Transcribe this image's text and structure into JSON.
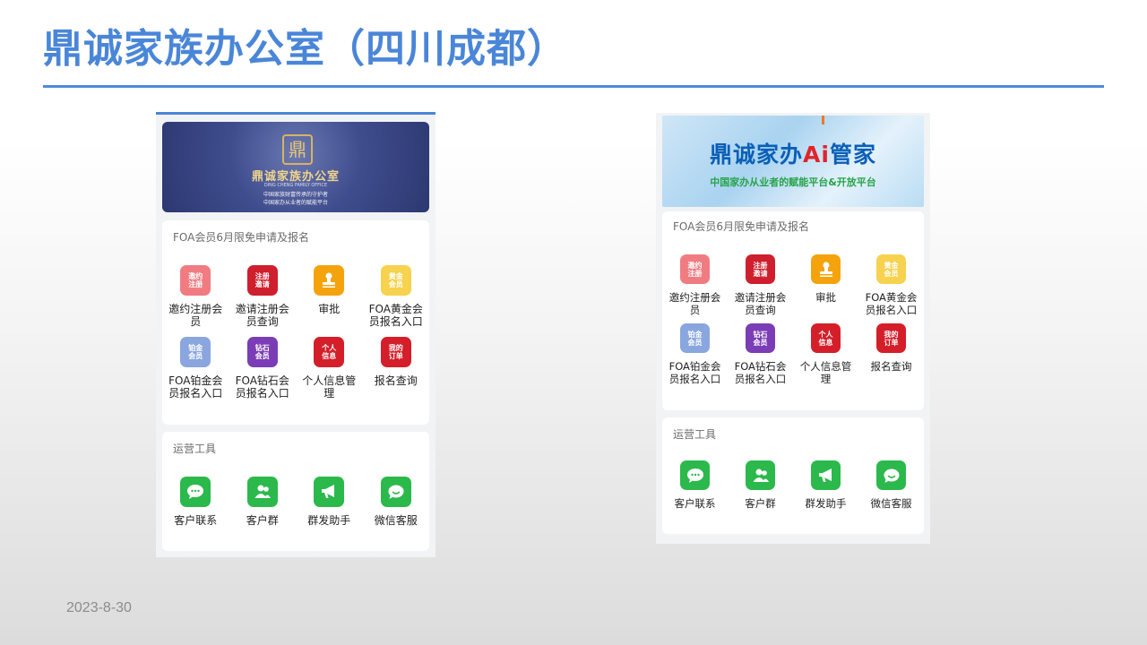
{
  "slide": {
    "title": "鼎诚家族办公室（四川成都）",
    "date": "2023-8-30",
    "accent_color": "#4a86d8"
  },
  "left_screen": {
    "banner": {
      "logo_glyph": "鼎",
      "name": "鼎诚家族办公室",
      "english": "DING CHENG FAMILY OFFICE",
      "slogan_1": "中国家族财富传承的守护者",
      "slogan_2": "中国家办从业者的赋能平台"
    },
    "foa": {
      "title": "FOA会员6月限免申请及报名",
      "items": [
        {
          "label": "邀约注册会员",
          "icon_text": "邀约注册",
          "icon": "invite-register-icon",
          "color": "#f07c82"
        },
        {
          "label": "邀请注册会员查询",
          "icon_text": "注册邀请",
          "icon": "invite-query-icon",
          "color": "#cf1f2e"
        },
        {
          "label": "审批",
          "icon_text": "",
          "icon": "approval-stamp-icon",
          "color": "#f5a30d"
        },
        {
          "label": "FOA黄金会员报名入口",
          "icon_text": "黄金会员",
          "icon": "gold-member-icon",
          "color": "#f6d24e"
        },
        {
          "label": "FOA铂金会员报名入口",
          "icon_text": "铂金会员",
          "icon": "platinum-member-icon",
          "color": "#8aa6de"
        },
        {
          "label": "FOA钻石会员报名入口",
          "icon_text": "钻石会员",
          "icon": "diamond-member-icon",
          "color": "#7b3db6"
        },
        {
          "label": "个人信息管理",
          "icon_text": "个人信息",
          "icon": "personal-info-icon",
          "color": "#d41f2a"
        },
        {
          "label": "报名查询",
          "icon_text": "我的订单",
          "icon": "my-orders-icon",
          "color": "#d41f2a"
        }
      ]
    },
    "tools": {
      "title": "运营工具",
      "items": [
        {
          "label": "客户联系",
          "icon": "chat-bubble-icon"
        },
        {
          "label": "客户群",
          "icon": "customer-group-icon"
        },
        {
          "label": "群发助手",
          "icon": "megaphone-icon"
        },
        {
          "label": "微信客服",
          "icon": "wechat-service-icon"
        }
      ]
    }
  },
  "right_screen": {
    "banner": {
      "name_pre": "鼎诚家办",
      "name_ai": "Ai",
      "name_post": "管家",
      "subtitle": "中国家办从业者的赋能平台&开放平台"
    },
    "foa": {
      "title": "FOA会员6月限免申请及报名",
      "items": [
        {
          "label": "邀约注册会员",
          "icon_text": "邀约注册",
          "icon": "invite-register-icon",
          "color": "#f07c82"
        },
        {
          "label": "邀请注册会员查询",
          "icon_text": "注册邀请",
          "icon": "invite-query-icon",
          "color": "#cf1f2e"
        },
        {
          "label": "审批",
          "icon_text": "",
          "icon": "approval-stamp-icon",
          "color": "#f5a30d"
        },
        {
          "label": "FOA黄金会员报名入口",
          "icon_text": "黄金会员",
          "icon": "gold-member-icon",
          "color": "#f6d24e"
        },
        {
          "label": "FOA铂金会员报名入口",
          "icon_text": "铂金会员",
          "icon": "platinum-member-icon",
          "color": "#8aa6de"
        },
        {
          "label": "FOA钻石会员报名入口",
          "icon_text": "钻石会员",
          "icon": "diamond-member-icon",
          "color": "#7b3db6"
        },
        {
          "label": "个人信息管理",
          "icon_text": "个人信息",
          "icon": "personal-info-icon",
          "color": "#d41f2a"
        },
        {
          "label": "报名查询",
          "icon_text": "我的订单",
          "icon": "my-orders-icon",
          "color": "#d41f2a"
        }
      ]
    },
    "tools": {
      "title": "运营工具",
      "items": [
        {
          "label": "客户联系",
          "icon": "chat-bubble-icon"
        },
        {
          "label": "客户群",
          "icon": "customer-group-icon"
        },
        {
          "label": "群发助手",
          "icon": "megaphone-icon"
        },
        {
          "label": "微信客服",
          "icon": "wechat-service-icon"
        }
      ]
    }
  }
}
